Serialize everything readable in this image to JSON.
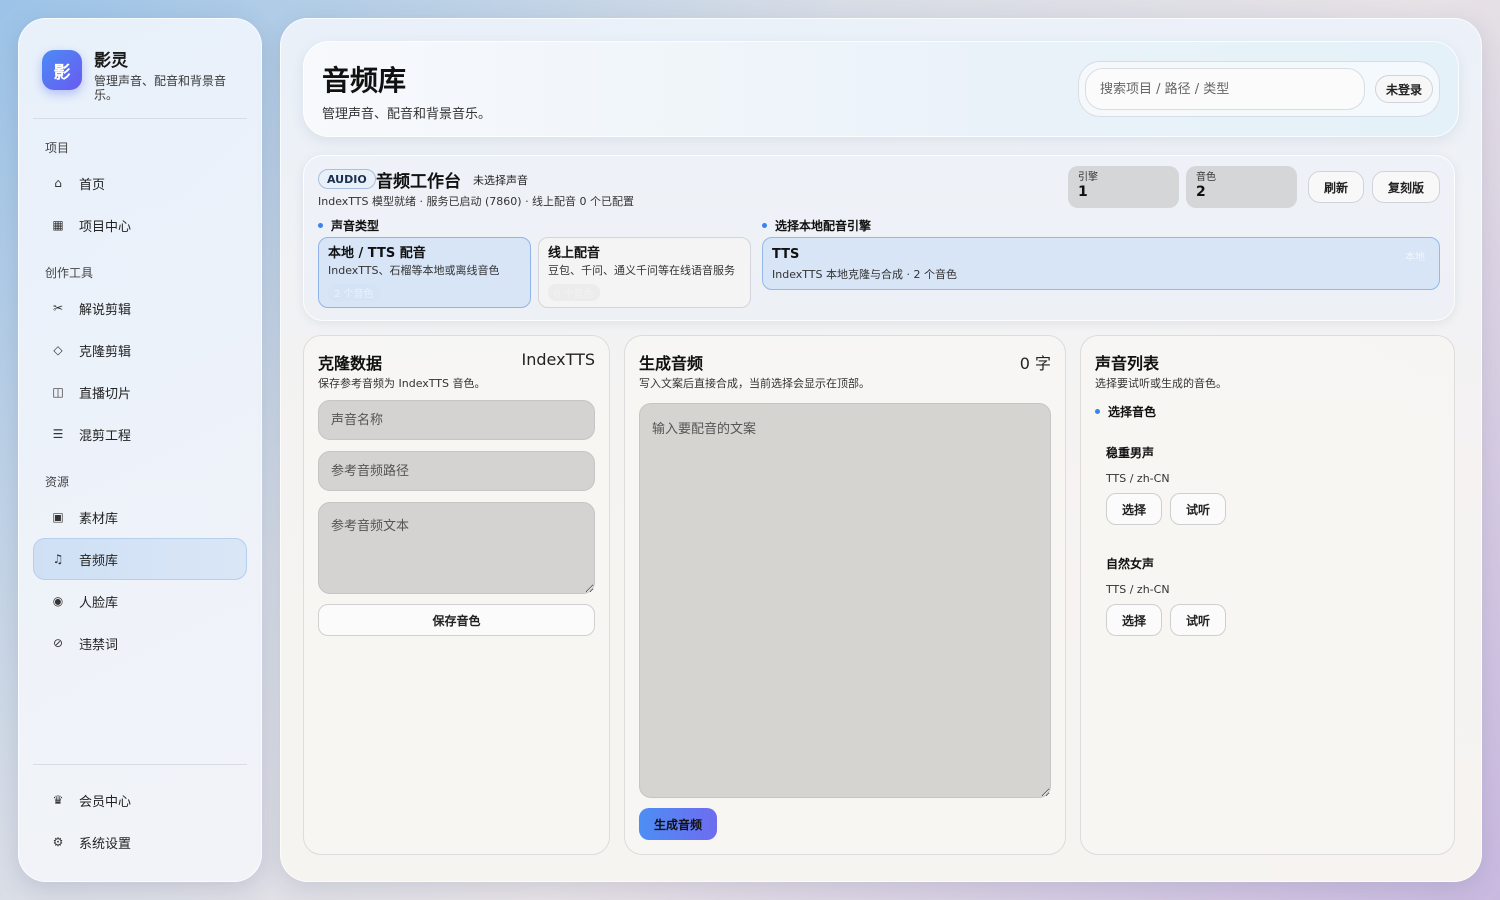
{
  "brand": {
    "logo_char": "影",
    "name": "影灵",
    "description": "管理声音、配音和背景音乐。"
  },
  "sidebar": {
    "sections": [
      {
        "label": "项目"
      },
      {
        "label": "创作工具"
      },
      {
        "label": "资源"
      }
    ],
    "items": [
      {
        "label": "首页",
        "icon": "home-icon",
        "glyph": "⌂"
      },
      {
        "label": "项目中心",
        "icon": "grid-icon",
        "glyph": "▦"
      },
      {
        "label": "解说剪辑",
        "icon": "scissors-icon",
        "glyph": "✂"
      },
      {
        "label": "克隆剪辑",
        "icon": "diamond-icon",
        "glyph": "◇"
      },
      {
        "label": "直播切片",
        "icon": "columns-icon",
        "glyph": "◫"
      },
      {
        "label": "混剪工程",
        "icon": "list-icon",
        "glyph": "☰"
      },
      {
        "label": "素材库",
        "icon": "box-icon",
        "glyph": "▣"
      },
      {
        "label": "音频库",
        "icon": "music-note-icon",
        "glyph": "♫",
        "active": true
      },
      {
        "label": "人脸库",
        "icon": "face-icon",
        "glyph": "◉"
      },
      {
        "label": "违禁词",
        "icon": "forbidden-icon",
        "glyph": "⊘"
      },
      {
        "label": "会员中心",
        "icon": "crown-icon",
        "glyph": "♛"
      },
      {
        "label": "系统设置",
        "icon": "settings-icon",
        "glyph": "⚙"
      }
    ]
  },
  "header": {
    "title": "音频库",
    "subtitle": "管理声音、配音和背景音乐。",
    "search_placeholder": "搜索项目 / 路径 / 类型",
    "login_label": "未登录"
  },
  "workbench": {
    "badge": "AUDIO",
    "title": "音频工作台",
    "status": "未选择声音",
    "meta": "IndexTTS 模型就绪 · 服务已启动 (7860) · 线上配音 0 个已配置",
    "stats": [
      {
        "label": "引擎",
        "value": "1"
      },
      {
        "label": "音色",
        "value": "2"
      }
    ],
    "refresh_label": "刷新",
    "copy_label": "复刻版",
    "voice_type_label": "声音类型",
    "engine_label": "选择本地配音引擎",
    "voice_types": [
      {
        "title": "本地 / TTS 配音",
        "desc": "IndexTTS、石榴等本地或离线音色",
        "count": "2 个音色",
        "selected": true
      },
      {
        "title": "线上配音",
        "desc": "豆包、千问、通义千问等在线语音服务",
        "count": "0 个音色",
        "selected": false
      }
    ],
    "engine": {
      "title": "TTS",
      "desc": "IndexTTS 本地克隆与合成 · 2 个音色",
      "tag": "本地"
    }
  },
  "clone_panel": {
    "title": "克隆数据",
    "engine": "IndexTTS",
    "subtitle": "保存参考音频为 IndexTTS 音色。",
    "name_placeholder": "声音名称",
    "path_placeholder": "参考音频路径",
    "text_placeholder": "参考音频文本",
    "save_label": "保存音色"
  },
  "generate_panel": {
    "title": "生成音频",
    "char_count": "0 字",
    "subtitle": "写入文案后直接合成，当前选择会显示在顶部。",
    "text_placeholder": "输入要配音的文案",
    "generate_label": "生成音频"
  },
  "voice_list": {
    "title": "声音列表",
    "subtitle": "选择要试听或生成的音色。",
    "section_label": "选择音色",
    "voices": [
      {
        "name": "稳重男声",
        "tags": "TTS / zh-CN",
        "select_label": "选择",
        "preview_label": "试听"
      },
      {
        "name": "自然女声",
        "tags": "TTS / zh-CN",
        "select_label": "选择",
        "preview_label": "试听"
      }
    ]
  },
  "colors": {
    "accent": "#3a82ef",
    "active_bg": "#cfe0f5",
    "primary_button": "#5a7ef2"
  }
}
